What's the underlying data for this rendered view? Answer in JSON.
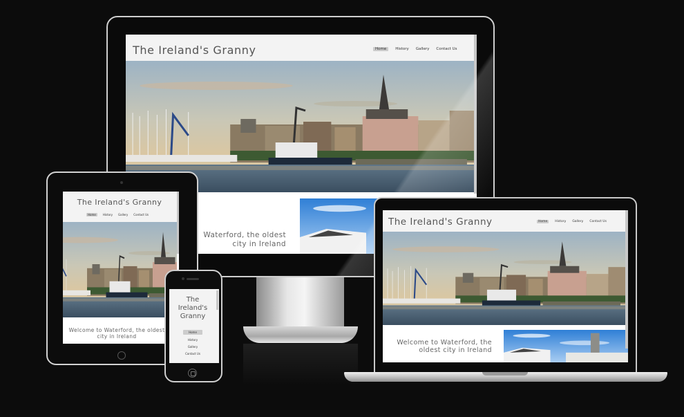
{
  "site": {
    "title": "The Ireland's Granny",
    "nav": [
      {
        "label": "Home",
        "active": true
      },
      {
        "label": "History",
        "active": false
      },
      {
        "label": "Gallery",
        "active": false
      },
      {
        "label": "Contact Us",
        "active": false
      }
    ],
    "welcome_full": "Welcome to Waterford, the oldest city in Ireland",
    "welcome_cut": "Waterford, the oldest city in Ireland",
    "phone_title_lines": [
      "The",
      "Ireland's",
      "Granny"
    ]
  },
  "colors": {
    "background": "#0c0c0c",
    "header": "#f3f3f3",
    "active_nav": "#cccccc"
  }
}
